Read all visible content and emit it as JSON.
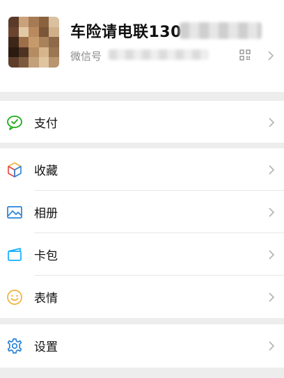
{
  "profile": {
    "name": "车险请电联130",
    "wechat_id_label": "微信号",
    "icons": [
      "qr-code-icon",
      "chevron-right-icon"
    ]
  },
  "menu": {
    "pay": {
      "label": "支付",
      "icon": "wechat-pay-icon"
    },
    "favorites": {
      "label": "收藏",
      "icon": "favorites-cube-icon"
    },
    "album": {
      "label": "相册",
      "icon": "album-icon"
    },
    "cards": {
      "label": "卡包",
      "icon": "card-wallet-icon"
    },
    "stickers": {
      "label": "表情",
      "icon": "smiley-icon"
    },
    "settings": {
      "label": "设置",
      "icon": "gear-icon"
    }
  },
  "colors": {
    "background": "#ededed",
    "card": "#ffffff",
    "pay_green": "#1aad19",
    "album_blue": "#2782d7",
    "cards_teal": "#10aeff",
    "smiley_yellow": "#f0b135",
    "settings_blue": "#2782d7",
    "text_primary": "#111111",
    "text_secondary": "#8a8a8a",
    "chevron": "#b2b2b2"
  }
}
